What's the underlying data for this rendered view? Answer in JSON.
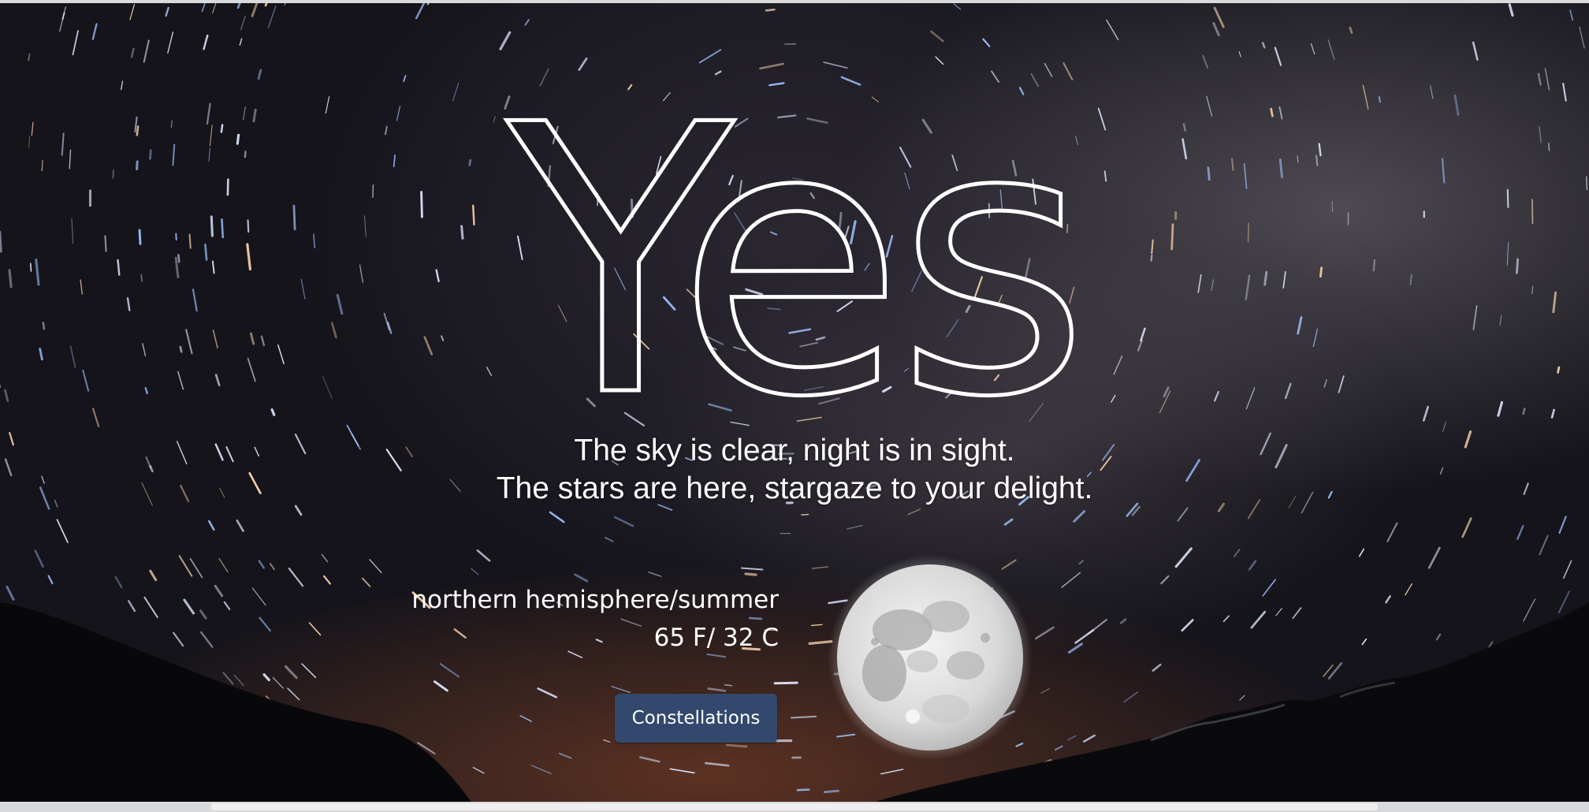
{
  "hero": {
    "title": "Yes",
    "tagline_line1": "The sky is clear, night is in sight.",
    "tagline_line2": "The stars are here, stargaze to your delight."
  },
  "conditions": {
    "location_season": "northern hemisphere/summer",
    "temperature": "65 F/ 32 C"
  },
  "actions": {
    "constellations_label": "Constellations"
  },
  "moon": {
    "phase": "full-moon"
  },
  "colors": {
    "button": "#32496d",
    "text": "#ffffff",
    "sky": "#15141b"
  }
}
